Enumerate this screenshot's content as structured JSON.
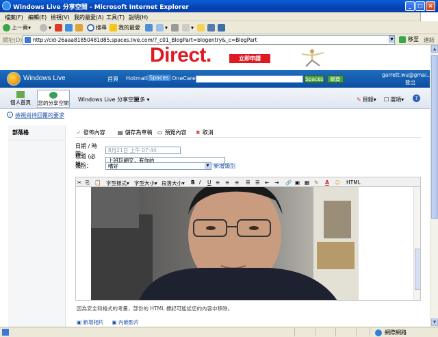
{
  "window": {
    "title": "Windows Live 分享空間 - Microsoft Internet Explorer"
  },
  "menu": [
    "檔案(F)",
    "編輯(E)",
    "檢視(V)",
    "我的最愛(A)",
    "工具(T)",
    "說明(H)"
  ],
  "toolbar": {
    "back": "上一頁",
    "search": "搜尋",
    "favorites": "我的最愛"
  },
  "address": {
    "label": "網址(D)",
    "url": "http://cid-26aaa81850481d85.spaces.live.com/?_c01_BlogPart=blogentry&_c=BlogPart",
    "go": "移至",
    "links": "連結"
  },
  "banner": {
    "brand": "Direct.",
    "apply": "立即申請"
  },
  "wl": {
    "logo_text": "Windows Live",
    "nav": [
      "首頁",
      "Hotmail",
      "Spaces",
      "OneCare"
    ],
    "search_btn": "Spaces",
    "web_btn": "網頁",
    "user": "garrett.wu@gmai...",
    "logout": "登出"
  },
  "space_nav": {
    "home": "個人首頁",
    "space": "您的分享空間",
    "space_title": "Windows Live 分享空間",
    "more": "更多",
    "catalog": "目錄",
    "options": "選項",
    "help": "?"
  },
  "notice": "檢視尚待回覆的要求",
  "left_panel": {
    "header": "部落格"
  },
  "editor_tools": {
    "publish": "發佈內容",
    "save_draft": "儲存為草稿",
    "preview": "預覽內容",
    "cancel": "取消"
  },
  "form": {
    "date_label": "日期 / 時間：",
    "date_value": "8月21日 上午 07:44",
    "title_label": "標題 (必填)：",
    "title_value": "上班玩網交，有你的",
    "category_label": "類別：",
    "category_value": "嗜好",
    "new_category": "新增類別"
  },
  "rte": {
    "font_style": "字型樣式",
    "font_size": "字型大小",
    "paragraph_size": "段落大小",
    "html": "HTML"
  },
  "footer_note": "因為安全和格式的考量，部份的 HTML 標記可能從您的內容中移除。",
  "footer_links": [
    "新增相片",
    "內嵌影片"
  ],
  "status": {
    "zone": "網際網路"
  },
  "colors": {
    "ie_title": "#0a5fd8",
    "wl_header": "#1e6dbc",
    "accent_red": "#e01a22"
  }
}
